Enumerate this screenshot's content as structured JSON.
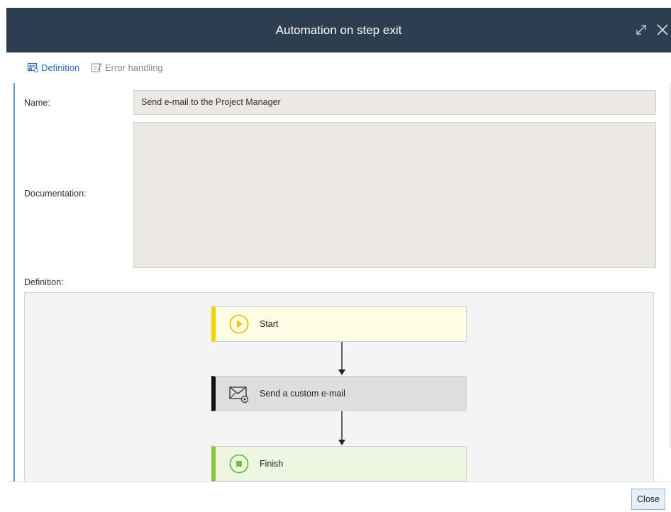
{
  "dialog": {
    "title": "Automation on step exit",
    "close_button": "Close"
  },
  "tabs": [
    {
      "label": "Definition",
      "active": true,
      "icon": "definition-icon"
    },
    {
      "label": "Error handling",
      "active": false,
      "icon": "error-handling-icon"
    }
  ],
  "form": {
    "name_label": "Name:",
    "name_value": "Send e-mail to the Project Manager",
    "documentation_label": "Documentation:",
    "documentation_value": "",
    "definition_label": "Definition:"
  },
  "workflow": {
    "nodes": [
      {
        "label": "Start",
        "icon": "play-icon",
        "accent": "#f2d500"
      },
      {
        "label": "Send a custom e-mail",
        "icon": "email-gear-icon",
        "accent": "#111111"
      },
      {
        "label": "Finish",
        "icon": "stop-icon",
        "accent": "#8cc43e"
      }
    ]
  },
  "colors": {
    "titlebar": "#2d3e50",
    "tab_active": "#2d6db5",
    "content_accent": "#5b9bd5"
  }
}
